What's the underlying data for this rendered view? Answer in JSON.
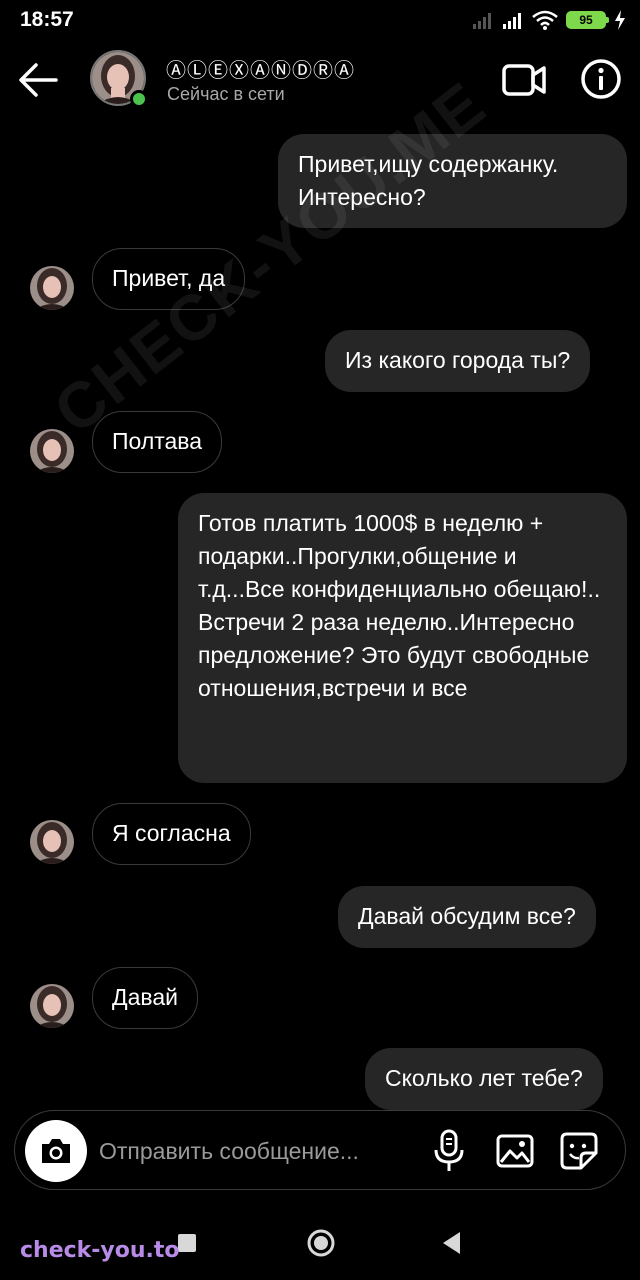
{
  "status_bar": {
    "time": "18:57",
    "battery_level": "95"
  },
  "header": {
    "contact_name": "ⒶⓁⒺⓍⒶⓃⒹⓇⒶ",
    "contact_status": "Сейчас в сети",
    "icons": [
      "back-arrow-icon",
      "video-camera-icon",
      "info-icon"
    ]
  },
  "watermark": {
    "text": "CHECK-YOU.ME"
  },
  "messages": [
    {
      "from": "me",
      "text": "Привет,ищу содержанку. Интересно?"
    },
    {
      "from": "contact",
      "text": "Привет, да"
    },
    {
      "from": "me",
      "text": "Из какого города ты?"
    },
    {
      "from": "contact",
      "text": "Полтава"
    },
    {
      "from": "me",
      "text": "Готов платить 1000$ в неделю + подарки..Прогулки,общение и т.д...Все конфиденциально обещаю!.. Встречи 2 раза неделю..Интересно предложение? Это будут свободные отношения,встречи и все"
    },
    {
      "from": "contact",
      "text": "Я согласна"
    },
    {
      "from": "me",
      "text": "Давай обсудим все?"
    },
    {
      "from": "contact",
      "text": "Давай"
    },
    {
      "from": "me",
      "text": "Сколько лет тебе?"
    }
  ],
  "composer": {
    "placeholder": "Отправить сообщение...",
    "icons": [
      "camera-icon",
      "microphone-icon",
      "gallery-icon",
      "sticker-icon"
    ]
  },
  "footer": {
    "brand": "check-you.to"
  },
  "colors": {
    "background": "#000000",
    "sent_bubble": "#262626",
    "received_border": "#3a3a3a",
    "online": "#4cc34c",
    "battery": "#7dd84b",
    "brand": "#b98be8"
  }
}
